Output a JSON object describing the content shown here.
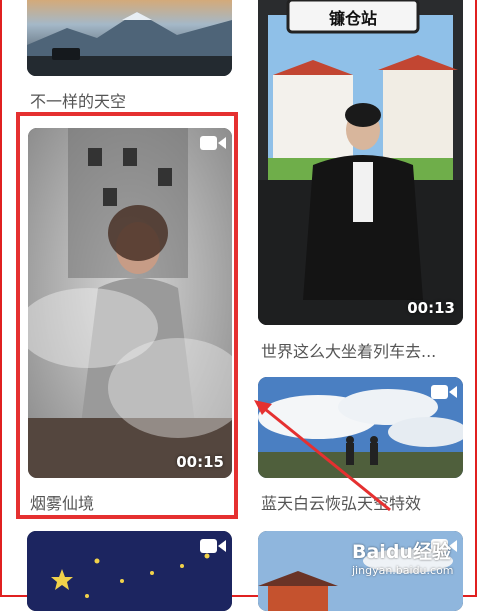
{
  "feed": {
    "cards": [
      {
        "caption": "不一样的天空"
      },
      {
        "caption": "烟雾仙境",
        "duration": "00:15"
      },
      {
        "station_sign": "镰仓站",
        "caption": "世界这么大坐着列车去...",
        "duration": "00:13"
      },
      {
        "caption": "蓝天白云恢弘天空特效"
      },
      {
        "caption": ""
      },
      {
        "caption": ""
      }
    ]
  },
  "watermark": {
    "logo": "Baidu经验",
    "url": "jingyan.baidu.com"
  },
  "colors": {
    "highlight": "#e53030",
    "frame": "#e02020"
  }
}
